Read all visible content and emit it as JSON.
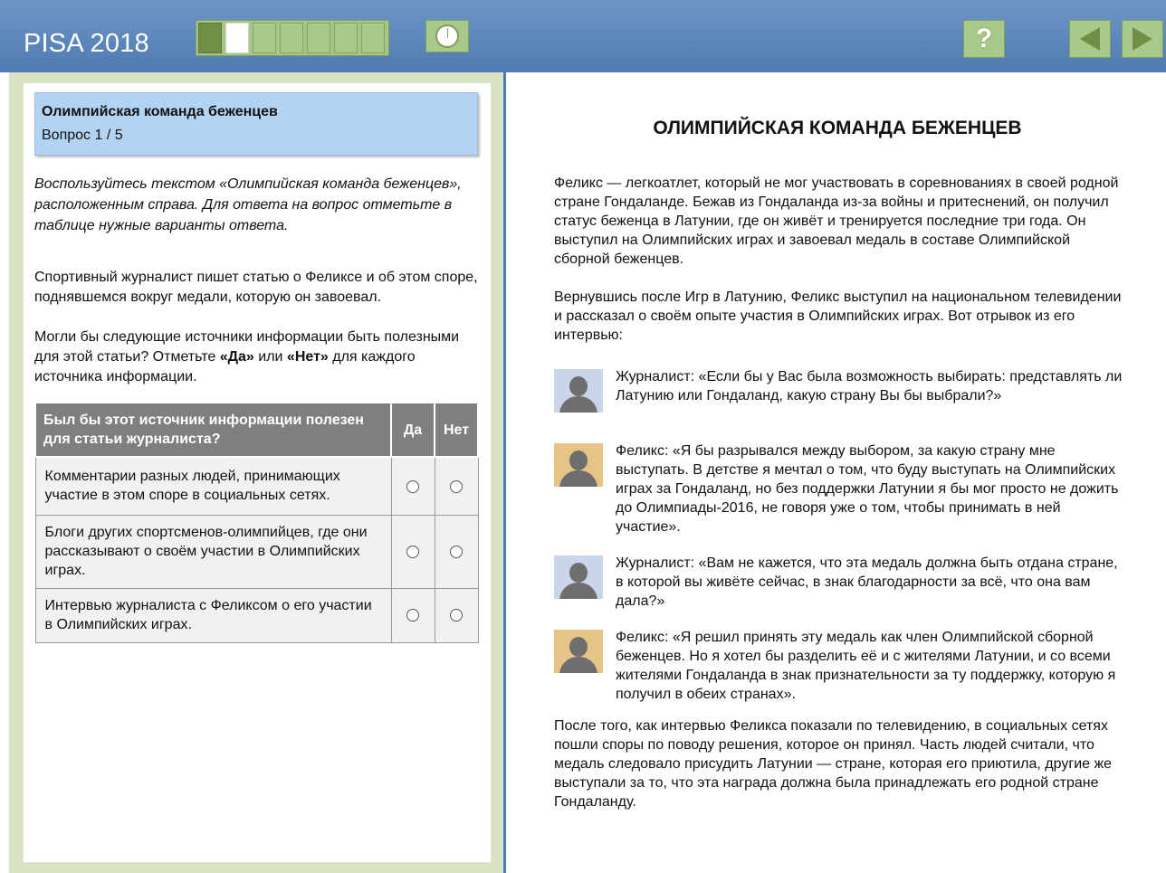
{
  "header": {
    "brand": "PISA 2018",
    "progress": {
      "total_segments": 7,
      "completed": 1,
      "current": 2
    },
    "help_label": "?"
  },
  "question_card": {
    "title": "Олимпийская команда беженцев",
    "number": "Вопрос 1 / 5"
  },
  "instructions": "Воспользуйтесь текстом «Олимпийская команда беженцев», расположенным справа. Для ответа на вопрос отметьте в таблице нужные варианты ответа.",
  "question": {
    "p1": "Спортивный журналист пишет статью о Феликсе и об этом споре, поднявшемся вокруг медали, которую он завоевал.",
    "p2_before": "Могли бы следующие источники информации быть полезными для этой статьи? Отметьте ",
    "p2_yes": "«Да»",
    "p2_mid": " или ",
    "p2_no": "«Нет»",
    "p2_after": " для каждого источника информации."
  },
  "table": {
    "header": "Был бы этот источник информации полезен для статьи журналиста?",
    "col_yes": "Да",
    "col_no": "Нет",
    "rows": [
      "Комментарии разных людей, принимающих участие в этом споре в социальных сетях.",
      "Блоги других спортсменов-олимпийцев, где они рассказывают о своём участии в Олимпийских играх.",
      "Интервью журналиста с Феликсом о его участии в Олимпийских играх."
    ]
  },
  "stimulus": {
    "title": "ОЛИМПИЙСКАЯ КОМАНДА БЕЖЕНЦЕВ",
    "p1": "Феликс — легкоатлет, который не мог участвовать в соревнованиях в своей родной стране Гондаланде. Бежав из Гондаланда из-за войны и притеснений, он получил статус беженца в Латунии, где он живёт и тренируется последние три года. Он выступил на Олимпийских играх и завоевал медаль в составе Олимпийской сборной беженцев.",
    "p2": "Вернувшись после Игр в Латунию, Феликс выступил на национальном телевидении и рассказал о своём опыте участия в Олимпийских играх. Вот отрывок из его интервью:",
    "dialogue": [
      {
        "speaker": "journalist",
        "text": "Журналист: «Если бы у Вас была возможность выбирать: представлять ли Латунию или Гондаланд, какую страну Вы бы выбрали?»"
      },
      {
        "speaker": "felix",
        "text": "Феликс: «Я бы разрывался между выбором, за какую страну мне выступать. В детстве я мечтал о том, что буду выступать на Олимпийских играх за Гондаланд, но без поддержки Латунии я бы мог просто не дожить до Олимпиады-2016, не говоря уже о том, чтобы принимать в ней участие»."
      },
      {
        "speaker": "journalist",
        "text": "Журналист: «Вам не кажется, что эта медаль должна быть отдана стране, в которой вы живёте сейчас, в знак благодарности за всё, что она вам дала?»"
      },
      {
        "speaker": "felix",
        "text": "Феликс: «Я решил принять эту медаль как член Олимпийской сборной беженцев. Но я хотел бы разделить её и с жителями Латунии, и со всеми жителями Гондаланда в знак признательности за ту поддержку, которую я получил в обеих странах»."
      }
    ],
    "p3": "После того, как интервью Феликса показали по телевидению, в социальных сетях пошли споры по поводу решения, которое он принял. Часть людей считали, что медаль следовало присудить Латунии — стране, которая его приютила, другие же выступали за то, что эта награда должна была принадлежать его родной стране Гондаланду."
  },
  "colors": {
    "header_blue": "#4f7bb2",
    "button_green": "#a8c88c",
    "progress_done": "#6f8f45",
    "question_card": "#b3d3f3",
    "table_header": "#7f7f7f"
  },
  "icons": [
    "timer-icon",
    "help-icon",
    "arrow-left-icon",
    "arrow-right-icon",
    "avatar-journalist-icon",
    "avatar-felix-icon"
  ]
}
